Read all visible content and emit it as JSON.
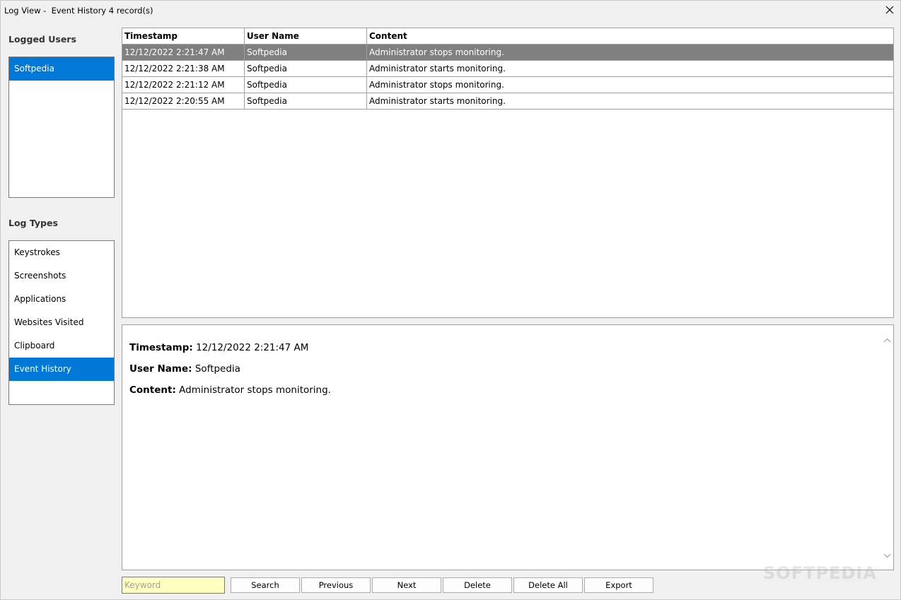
{
  "window": {
    "title": "Log View -  Event History 4 record(s)",
    "close_icon": "close-icon"
  },
  "sidebar": {
    "logged_users_heading": "Logged Users",
    "users": [
      {
        "label": "Softpedia",
        "selected": true
      }
    ],
    "log_types_heading": "Log Types",
    "log_types": [
      {
        "label": "Keystrokes",
        "selected": false
      },
      {
        "label": "Screenshots",
        "selected": false
      },
      {
        "label": "Applications",
        "selected": false
      },
      {
        "label": "Websites Visited",
        "selected": false
      },
      {
        "label": "Clipboard",
        "selected": false
      },
      {
        "label": "Event History",
        "selected": true
      }
    ]
  },
  "table": {
    "columns": [
      "Timestamp",
      "User Name",
      "Content"
    ],
    "rows": [
      {
        "timestamp": "12/12/2022 2:21:47 AM",
        "user": "Softpedia",
        "content": "Administrator stops monitoring.",
        "selected": true
      },
      {
        "timestamp": "12/12/2022 2:21:38 AM",
        "user": "Softpedia",
        "content": "Administrator starts monitoring.",
        "selected": false
      },
      {
        "timestamp": "12/12/2022 2:21:12 AM",
        "user": "Softpedia",
        "content": "Administrator stops monitoring.",
        "selected": false
      },
      {
        "timestamp": "12/12/2022 2:20:55 AM",
        "user": "Softpedia",
        "content": "Administrator starts monitoring.",
        "selected": false
      }
    ]
  },
  "detail": {
    "timestamp_label": "Timestamp:",
    "timestamp_value": "12/12/2022 2:21:47 AM",
    "user_label": "User Name:",
    "user_value": "Softpedia",
    "content_label": "Content:",
    "content_value": "Administrator stops monitoring."
  },
  "toolbar": {
    "keyword_placeholder": "Keyword",
    "keyword_value": "",
    "search_label": "Search",
    "previous_label": "Previous",
    "next_label": "Next",
    "delete_label": "Delete",
    "delete_all_label": "Delete All",
    "export_label": "Export"
  },
  "watermark": "SOFTPEDIA",
  "colors": {
    "selection_blue": "#0078d7",
    "row_selected_gray": "#808080",
    "keyword_bg": "#ffffc0"
  }
}
